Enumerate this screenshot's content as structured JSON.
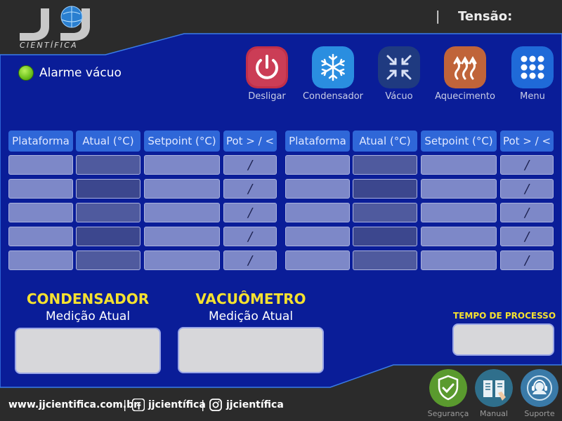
{
  "brand": {
    "logo_text": "CIENTÍFICA"
  },
  "header": {
    "separator": "|",
    "tensao_label": "Tensão:"
  },
  "alarm": {
    "label": "Alarme vácuo",
    "led_color": "#7bd021"
  },
  "actions": [
    {
      "id": "desligar",
      "label": "Desligar",
      "icon": "power-icon",
      "color": "#c0304a"
    },
    {
      "id": "condensador",
      "label": "Condensador",
      "icon": "snowflake-icon",
      "color": "#2a8ee0"
    },
    {
      "id": "vacuo",
      "label": "Vácuo",
      "icon": "compress-arrows-icon",
      "color": "#1f3a80"
    },
    {
      "id": "aquecimento",
      "label": "Aquecimento",
      "icon": "heat-waves-icon",
      "color": "#c0643a"
    },
    {
      "id": "menu",
      "label": "Menu",
      "icon": "grid-dots-icon",
      "color": "#1f6ad8"
    }
  ],
  "tables": {
    "headers": [
      "Plataforma",
      "Atual (°C)",
      "Setpoint (°C)",
      "Pot > / <"
    ],
    "rows": 5,
    "slash": "/"
  },
  "measurements": {
    "condensador": {
      "title": "CONDENSADOR",
      "subtitle": "Medição Atual"
    },
    "vacuometro": {
      "title": "VACUÔMETRO",
      "subtitle": "Medição Atual"
    },
    "processo": {
      "title": "TEMPO DE PROCESSO"
    }
  },
  "footer": {
    "website": "www.jjcientifica.com.br",
    "separator": "|",
    "facebook": "jjcientífica",
    "instagram": "jjcientífica",
    "buttons": [
      {
        "id": "seguranca",
        "label": "Segurança",
        "icon": "shield-check-icon",
        "color": "#5a9a2e"
      },
      {
        "id": "manual",
        "label": "Manual",
        "icon": "manual-book-icon",
        "color": "#2f6f8c"
      },
      {
        "id": "suporte",
        "label": "Suporte",
        "icon": "headset-icon",
        "color": "#3a7aa8"
      }
    ]
  }
}
